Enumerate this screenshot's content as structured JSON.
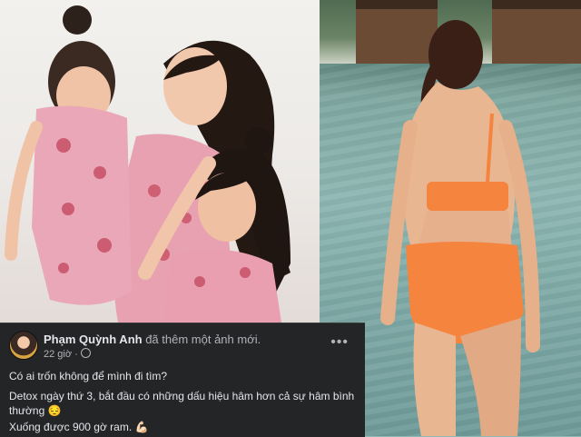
{
  "post": {
    "author": "Phạm Quỳnh Anh",
    "action": "đã thêm một ảnh mới.",
    "time": "22 giờ ·",
    "more_label": "•••",
    "line1": "Có ai trốn không để mình đi tìm?",
    "line2": "Detox ngày thứ 3, bắt đầu có những dấu hiệu hâm hơn cả sự hâm bình thường 😔",
    "line3": "Xuống được 900 gờ ram. 💪🏻"
  },
  "colors": {
    "card_bg": "#242526",
    "swimsuit": "#f5843f",
    "dress": "#e8a3b4"
  }
}
